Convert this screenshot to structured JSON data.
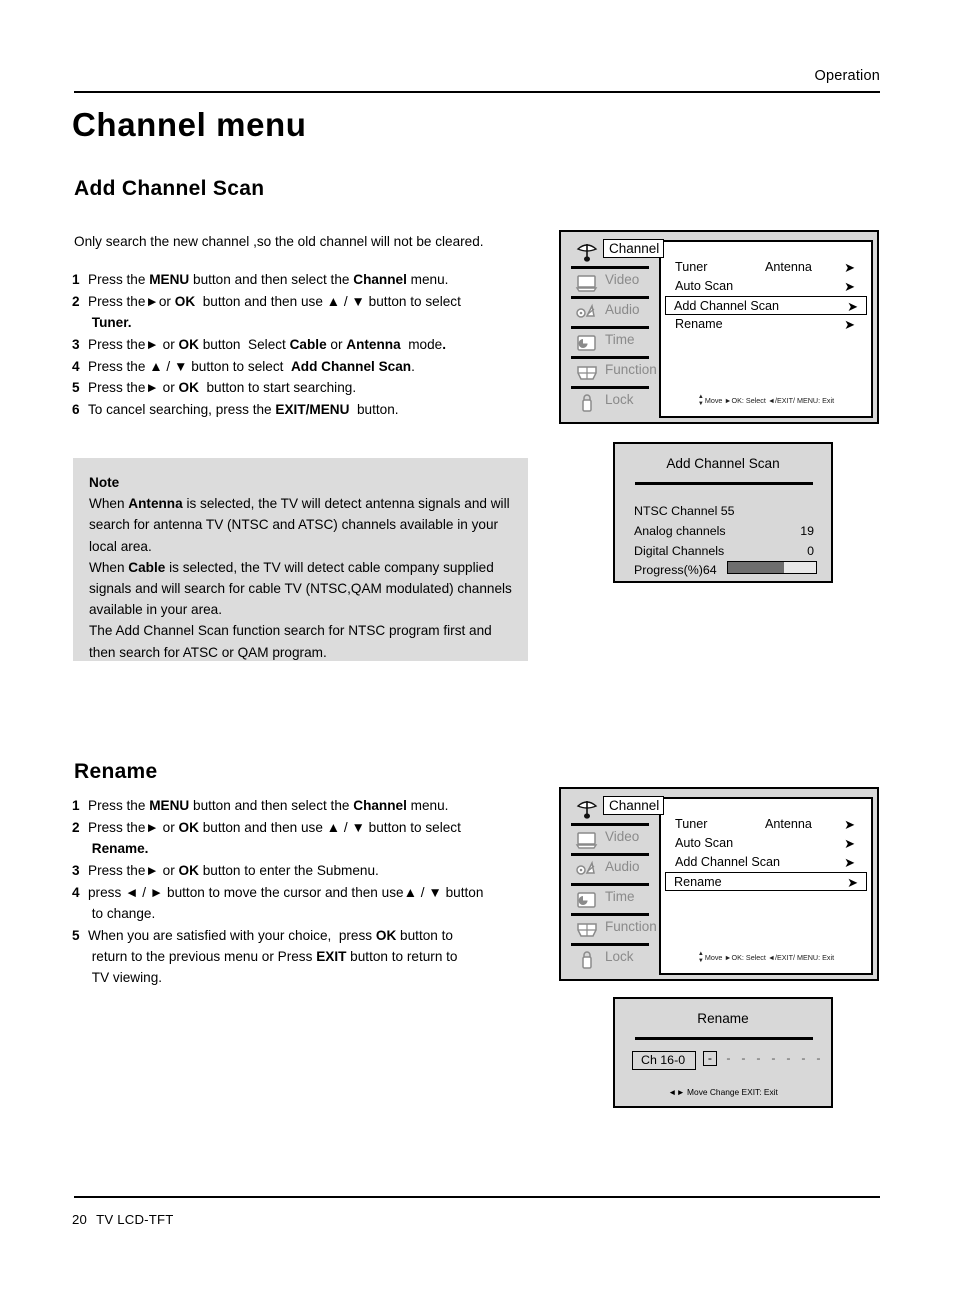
{
  "header": {
    "section": "Operation"
  },
  "title": "Channel menu",
  "sections": {
    "add_scan": {
      "heading": "Add Channel Scan",
      "intro": "Only search the new channel ,so the old channel will not be cleared.",
      "steps": [
        {
          "num": "1",
          "html": "Press the <b>MENU</b> button and then select the <b>Channel</b> menu."
        },
        {
          "num": "2",
          "html": "Press the&#9658;or <b>OK</b>&nbsp; button and then use &#9650; / &#9660; button to select<br><b>&nbsp;Tuner.</b>"
        },
        {
          "num": "3",
          "html": "Press the&#9658; or <b>OK</b> button&nbsp; Select <b>Cable</b> or <b>Antenna</b>&nbsp; mode<b>.</b>"
        },
        {
          "num": "4",
          "html": "Press the &#9650; / &#9660; button to select&nbsp; <b>Add Channel Scan</b>."
        },
        {
          "num": "5",
          "html": "Press the&#9658; or <b>OK</b>&nbsp; button to start searching."
        },
        {
          "num": "6",
          "html": "To cancel searching, press the <b>EXIT/MENU</b>&nbsp; button."
        }
      ]
    },
    "note": {
      "title": "Note",
      "paragraphs": [
        "When <b>Antenna</b> is selected, the TV will detect antenna signals and will search for antenna TV (NTSC and ATSC) channels available in your local area.",
        "When <b>Cable</b> is selected, the TV will detect cable company supplied signals and will search for cable TV (NTSC,QAM modulated) channels available in your area.",
        "The Add Channel Scan function search for NTSC program first and then search for ATSC or QAM program."
      ]
    },
    "rename": {
      "heading": "Rename",
      "steps": [
        {
          "num": "1",
          "html": "Press the <b>MENU</b> button and then select the <b>Channel</b> menu."
        },
        {
          "num": "2",
          "html": "Press the&#9658; or <b>OK</b> button and then use &#9650; / &#9660; button to select<br><b>&nbsp;Rename.</b>"
        },
        {
          "num": "3",
          "html": "Press the&#9658; or <b>OK</b> button to enter the Submenu."
        },
        {
          "num": "4",
          "html": "press &#9668; / &#9658; button to move the cursor and then use&#9650; / &#9660; button<br>&nbsp;to change."
        },
        {
          "num": "5",
          "html": "When you are satisfied with your choice,&nbsp; press <b>OK</b> button to<br>&nbsp;return to the previous menu or Press <b>EXIT</b> button to return to<br>&nbsp;TV viewing."
        }
      ]
    }
  },
  "osd": {
    "sidebar": [
      {
        "label": "Channel",
        "icon": "satellite-dish-icon"
      },
      {
        "label": "Video",
        "icon": "monitor-icon"
      },
      {
        "label": "Audio",
        "icon": "speaker-icon"
      },
      {
        "label": "Time",
        "icon": "clock-icon"
      },
      {
        "label": "Function",
        "icon": "tray-icon"
      },
      {
        "label": "Lock",
        "icon": "padlock-icon"
      }
    ],
    "active_sidebar": "Channel",
    "menu_items": [
      {
        "label": "Tuner",
        "value": "Antenna",
        "arrow": "➤"
      },
      {
        "label": "Auto Scan",
        "value": "",
        "arrow": "➤"
      },
      {
        "label": "Add Channel Scan",
        "value": "",
        "arrow": "➤"
      },
      {
        "label": "Rename",
        "value": "",
        "arrow": "➤"
      }
    ],
    "hint": "Move  ►OK: Select  ◄/EXIT/ MENU: Exit",
    "selected_1": "Add Channel Scan",
    "selected_2": "Rename"
  },
  "scan_dialog": {
    "title": "Add Channel Scan",
    "lines": [
      {
        "label": "NTSC Channel 55",
        "value": ""
      },
      {
        "label": "Analog channels",
        "value": "19"
      },
      {
        "label": "Digital Channels",
        "value": "0"
      }
    ],
    "progress_label": "Progress(%)64",
    "progress_percent": 64
  },
  "rename_dialog": {
    "title": "Rename",
    "channel": "Ch 16-0",
    "chars": [
      "-",
      "-",
      "-",
      "-",
      "-",
      "-",
      "-",
      "-"
    ],
    "cursor_index": 0,
    "hint": "◄► Move  Change   EXIT: Exit"
  },
  "footer": {
    "page": "20",
    "product": "TV LCD-TFT"
  },
  "colors": {
    "osd_bg": "#d8d8d8",
    "panel_bg": "#ffffff",
    "note_bg": "#dcdcdc",
    "progress_fill": "#6e6e6e",
    "dim_text": "#8a8a8a"
  }
}
